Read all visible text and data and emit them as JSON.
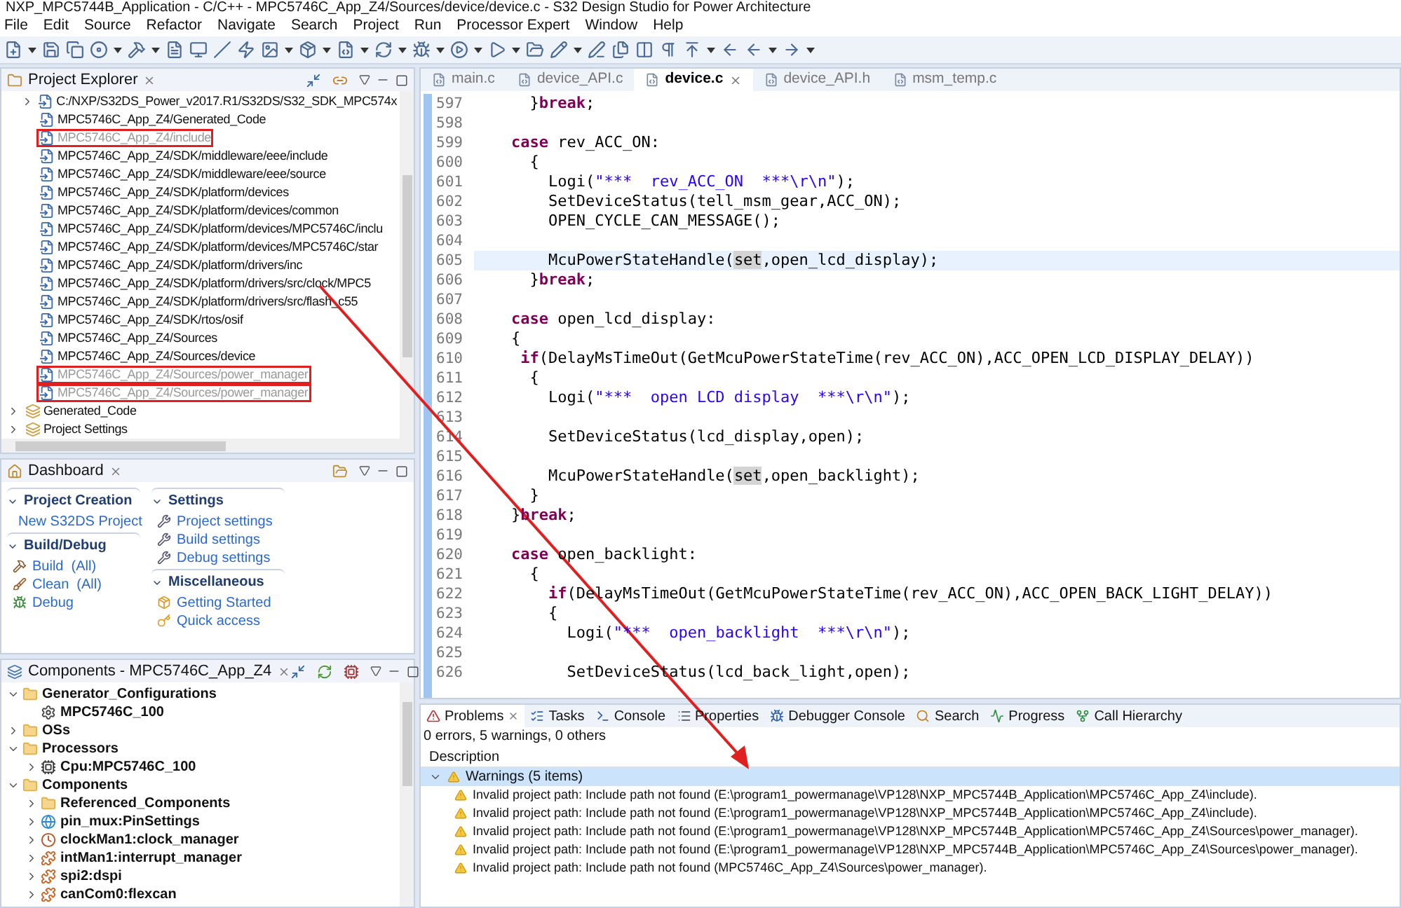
{
  "window": {
    "title": "NXP_MPC5744B_Application - C/C++ - MPC5746C_App_Z4/Sources/device/device.c - S32 Design Studio for Power Architecture"
  },
  "menu": [
    "File",
    "Edit",
    "Source",
    "Refactor",
    "Navigate",
    "Search",
    "Project",
    "Run",
    "Processor Expert",
    "Window",
    "Help"
  ],
  "project_explorer": {
    "title": "Project Explorer",
    "items": [
      {
        "label": "C:/NXP/S32DS_Power_v2017.R1/S32DS/S32_SDK_MPC574x",
        "kind": "include",
        "expanded": false,
        "disabled": false,
        "marked": false
      },
      {
        "label": "MPC5746C_App_Z4/Generated_Code",
        "kind": "include",
        "disabled": false,
        "marked": false
      },
      {
        "label": "MPC5746C_App_Z4/include",
        "kind": "include",
        "disabled": true,
        "marked": true
      },
      {
        "label": "MPC5746C_App_Z4/SDK/middleware/eee/include",
        "kind": "include",
        "disabled": false,
        "marked": false
      },
      {
        "label": "MPC5746C_App_Z4/SDK/middleware/eee/source",
        "kind": "include",
        "disabled": false,
        "marked": false
      },
      {
        "label": "MPC5746C_App_Z4/SDK/platform/devices",
        "kind": "include",
        "disabled": false,
        "marked": false
      },
      {
        "label": "MPC5746C_App_Z4/SDK/platform/devices/common",
        "kind": "include",
        "disabled": false,
        "marked": false
      },
      {
        "label": "MPC5746C_App_Z4/SDK/platform/devices/MPC5746C/inclu",
        "kind": "include",
        "disabled": false,
        "marked": false
      },
      {
        "label": "MPC5746C_App_Z4/SDK/platform/devices/MPC5746C/star",
        "kind": "include",
        "disabled": false,
        "marked": false
      },
      {
        "label": "MPC5746C_App_Z4/SDK/platform/drivers/inc",
        "kind": "include",
        "disabled": false,
        "marked": false
      },
      {
        "label": "MPC5746C_App_Z4/SDK/platform/drivers/src/clock/MPC5",
        "kind": "include",
        "disabled": false,
        "marked": false
      },
      {
        "label": "MPC5746C_App_Z4/SDK/platform/drivers/src/flash_c55",
        "kind": "include",
        "disabled": false,
        "marked": false
      },
      {
        "label": "MPC5746C_App_Z4/SDK/rtos/osif",
        "kind": "include",
        "disabled": false,
        "marked": false
      },
      {
        "label": "MPC5746C_App_Z4/Sources",
        "kind": "include",
        "disabled": false,
        "marked": false
      },
      {
        "label": "MPC5746C_App_Z4/Sources/device",
        "kind": "include",
        "disabled": false,
        "marked": false
      },
      {
        "label": "MPC5746C_App_Z4/Sources/power_manager",
        "kind": "include",
        "disabled": true,
        "marked": true
      },
      {
        "label": "MPC5746C_App_Z4/Sources/power_manager",
        "kind": "include",
        "disabled": true,
        "marked": true
      },
      {
        "label": "Generated_Code",
        "kind": "folder",
        "expanded": false,
        "disabled": false,
        "marked": false
      },
      {
        "label": "Project Settings",
        "kind": "folder",
        "expanded": false,
        "disabled": false,
        "marked": false
      }
    ]
  },
  "dashboard": {
    "title": "Dashboard",
    "columns": [
      [
        {
          "title": "Project Creation",
          "expanded": true,
          "links": [
            {
              "label": "New S32DS Project",
              "kind": "new"
            }
          ]
        },
        {
          "title": "Build/Debug",
          "expanded": true,
          "links": [
            {
              "label": "Build  (All)",
              "kind": "build"
            },
            {
              "label": "Clean  (All)",
              "kind": "clean"
            },
            {
              "label": "Debug",
              "kind": "debug"
            }
          ]
        }
      ],
      [
        {
          "title": "Settings",
          "expanded": true,
          "links": [
            {
              "label": "Project settings",
              "kind": "settings"
            },
            {
              "label": "Build settings",
              "kind": "settings"
            },
            {
              "label": "Debug settings",
              "kind": "settings"
            }
          ]
        },
        {
          "title": "Miscellaneous",
          "expanded": true,
          "links": [
            {
              "label": "Getting Started",
              "kind": "start"
            },
            {
              "label": "Quick access",
              "kind": "key"
            }
          ]
        }
      ]
    ]
  },
  "components": {
    "title": "Components - MPC5746C_App_Z4",
    "tree": [
      {
        "label": "Generator_Configurations",
        "kind": "folder",
        "expanded": true,
        "children": [
          {
            "label": "MPC5746C_100",
            "kind": "gear"
          }
        ]
      },
      {
        "label": "OSs",
        "kind": "folder",
        "expanded": false
      },
      {
        "label": "Processors",
        "kind": "folder",
        "expanded": true,
        "children": [
          {
            "label": "Cpu:MPC5746C_100",
            "kind": "cpu",
            "expanded": false
          }
        ]
      },
      {
        "label": "Components",
        "kind": "folder",
        "expanded": true,
        "children": [
          {
            "label": "Referenced_Components",
            "kind": "folder",
            "expanded": false
          },
          {
            "label": "pin_mux:PinSettings",
            "kind": "globe",
            "expanded": false
          },
          {
            "label": "clockMan1:clock_manager",
            "kind": "clock",
            "expanded": false
          },
          {
            "label": "intMan1:interrupt_manager",
            "kind": "component",
            "expanded": false
          },
          {
            "label": "spi2:dspi",
            "kind": "component",
            "expanded": false
          },
          {
            "label": "canCom0:flexcan",
            "kind": "component",
            "expanded": false
          }
        ]
      }
    ]
  },
  "editor": {
    "tabs": [
      {
        "label": "main.c",
        "selected": false
      },
      {
        "label": "device_API.c",
        "selected": false
      },
      {
        "label": "device.c",
        "selected": true
      },
      {
        "label": "device_API.h",
        "selected": false
      },
      {
        "label": "msm_temp.c",
        "selected": false
      }
    ],
    "lines": [
      {
        "number": "597",
        "current": false,
        "segments": [
          {
            "kind": "plain",
            "t": "      }"
          },
          {
            "kind": "keyword",
            "t": "break"
          },
          {
            "kind": "plain",
            "t": ";"
          }
        ]
      },
      {
        "number": "598",
        "current": false
      },
      {
        "number": "599",
        "current": false,
        "segments": [
          {
            "kind": "keyword",
            "t": "    case"
          },
          {
            "kind": "plain",
            "t": " rev_ACC_ON:"
          }
        ]
      },
      {
        "number": "600",
        "current": false,
        "segments": [
          {
            "kind": "plain",
            "t": "      {"
          }
        ]
      },
      {
        "number": "601",
        "current": false,
        "segments": [
          {
            "kind": "plain",
            "t": "        Logi("
          },
          {
            "kind": "string",
            "t": "\"***  rev_ACC_ON  ***\\r\\n\""
          },
          {
            "kind": "plain",
            "t": ");"
          }
        ]
      },
      {
        "number": "602",
        "current": false,
        "segments": [
          {
            "kind": "plain",
            "t": "        SetDeviceStatus(tell_msm_gear,ACC_ON);"
          }
        ]
      },
      {
        "number": "603",
        "current": false,
        "segments": [
          {
            "kind": "plain",
            "t": "        OPEN_CYCLE_CAN_MESSAGE();"
          }
        ]
      },
      {
        "number": "604",
        "current": false
      },
      {
        "number": "605",
        "current": true,
        "segments": [
          {
            "kind": "plain",
            "t": "        McuPowerStateHandle("
          },
          {
            "kind": "occurrence",
            "t": "set"
          },
          {
            "kind": "plain",
            "t": ",open_lcd_display);"
          }
        ]
      },
      {
        "number": "606",
        "current": false,
        "segments": [
          {
            "kind": "plain",
            "t": "      }"
          },
          {
            "kind": "keyword",
            "t": "break"
          },
          {
            "kind": "plain",
            "t": ";"
          }
        ]
      },
      {
        "number": "607",
        "current": false
      },
      {
        "number": "608",
        "current": false,
        "segments": [
          {
            "kind": "keyword",
            "t": "    case"
          },
          {
            "kind": "plain",
            "t": " open_lcd_display:"
          }
        ]
      },
      {
        "number": "609",
        "current": false,
        "segments": [
          {
            "kind": "plain",
            "t": "    {"
          }
        ]
      },
      {
        "number": "610",
        "current": false,
        "segments": [
          {
            "kind": "keyword",
            "t": "     if"
          },
          {
            "kind": "plain",
            "t": "(DelayMsTimeOut(GetMcuPowerStateTime(rev_ACC_ON),ACC_OPEN_LCD_DISPLAY_DELAY))"
          }
        ]
      },
      {
        "number": "611",
        "current": false,
        "segments": [
          {
            "kind": "plain",
            "t": "      {"
          }
        ]
      },
      {
        "number": "612",
        "current": false,
        "segments": [
          {
            "kind": "plain",
            "t": "        Logi("
          },
          {
            "kind": "string",
            "t": "\"***  open LCD display  ***\\r\\n\""
          },
          {
            "kind": "plain",
            "t": ");"
          }
        ]
      },
      {
        "number": "613",
        "current": false
      },
      {
        "number": "614",
        "current": false,
        "segments": [
          {
            "kind": "plain",
            "t": "        SetDeviceStatus(lcd_display,open);"
          }
        ]
      },
      {
        "number": "615",
        "current": false
      },
      {
        "number": "616",
        "current": false,
        "segments": [
          {
            "kind": "plain",
            "t": "        McuPowerStateHandle("
          },
          {
            "kind": "occurrence",
            "t": "set"
          },
          {
            "kind": "plain",
            "t": ",open_backlight);"
          }
        ]
      },
      {
        "number": "617",
        "current": false,
        "segments": [
          {
            "kind": "plain",
            "t": "      }"
          }
        ]
      },
      {
        "number": "618",
        "current": false,
        "segments": [
          {
            "kind": "plain",
            "t": "    }"
          },
          {
            "kind": "keyword",
            "t": "break"
          },
          {
            "kind": "plain",
            "t": ";"
          }
        ]
      },
      {
        "number": "619",
        "current": false
      },
      {
        "number": "620",
        "current": false,
        "segments": [
          {
            "kind": "keyword",
            "t": "    case"
          },
          {
            "kind": "plain",
            "t": " open_backlight:"
          }
        ]
      },
      {
        "number": "621",
        "current": false,
        "segments": [
          {
            "kind": "plain",
            "t": "      {"
          }
        ]
      },
      {
        "number": "622",
        "current": false,
        "segments": [
          {
            "kind": "keyword",
            "t": "        if"
          },
          {
            "kind": "plain",
            "t": "(DelayMsTimeOut(GetMcuPowerStateTime(rev_ACC_ON),ACC_OPEN_BACK_LIGHT_DELAY))"
          }
        ]
      },
      {
        "number": "623",
        "current": false,
        "segments": [
          {
            "kind": "plain",
            "t": "        {"
          }
        ]
      },
      {
        "number": "624",
        "current": false,
        "segments": [
          {
            "kind": "plain",
            "t": "          Logi("
          },
          {
            "kind": "string",
            "t": "\"***  open_backlight  ***\\r\\n\""
          },
          {
            "kind": "plain",
            "t": ");"
          }
        ]
      },
      {
        "number": "625",
        "current": false
      },
      {
        "number": "626",
        "current": false,
        "segments": [
          {
            "kind": "plain",
            "t": "          SetDeviceStatus(lcd_back_light,open);"
          }
        ]
      }
    ]
  },
  "problems": {
    "tabs": [
      {
        "label": "Problems",
        "kind": "problems",
        "selected": true
      },
      {
        "label": "Tasks",
        "kind": "tasks",
        "selected": false
      },
      {
        "label": "Console",
        "kind": "console",
        "selected": false
      },
      {
        "label": "Properties",
        "kind": "properties",
        "selected": false
      },
      {
        "label": "Debugger Console",
        "kind": "debugger",
        "selected": false
      },
      {
        "label": "Search",
        "kind": "search",
        "selected": false
      },
      {
        "label": "Progress",
        "kind": "progress",
        "selected": false
      },
      {
        "label": "Call Hierarchy",
        "kind": "hierarchy",
        "selected": false
      }
    ],
    "summary": "0 errors, 5 warnings, 0 others",
    "column": "Description",
    "group": {
      "label": "Warnings (5 items)",
      "expanded": true,
      "selected": true
    },
    "items": [
      "Invalid project path: Include path not found (E:\\program1_powermanage\\VP128\\NXP_MPC5744B_Application\\MPC5746C_App_Z4\\include).",
      "Invalid project path: Include path not found (E:\\program1_powermanage\\VP128\\NXP_MPC5744B_Application\\MPC5746C_App_Z4\\include).",
      "Invalid project path: Include path not found (E:\\program1_powermanage\\VP128\\NXP_MPC5744B_Application\\MPC5746C_App_Z4\\Sources\\power_manager).",
      "Invalid project path: Include path not found (E:\\program1_powermanage\\VP128\\NXP_MPC5744B_Application\\MPC5746C_App_Z4\\Sources\\power_manager).",
      "Invalid project path: Include path not found (MPC5746C_App_Z4\\Sources\\power_manager)."
    ]
  }
}
